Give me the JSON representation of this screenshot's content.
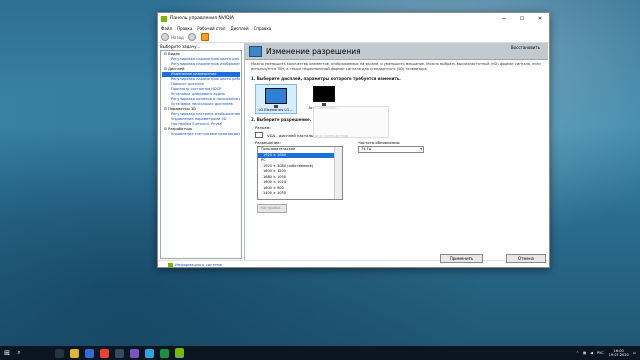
{
  "window": {
    "title": "Панель управления NVIDIA",
    "minimize": "—",
    "maximize": "☐",
    "close": "✕"
  },
  "menu": [
    "Файл",
    "Правка",
    "Рабочий стол",
    "Дисплей",
    "Справка"
  ],
  "toolbar": {
    "back": "Назад"
  },
  "left_panel": {
    "header": "Выберите задачу...",
    "tree": [
      {
        "type": "cat",
        "label": "⊟ Видео"
      },
      {
        "type": "it",
        "label": "Регулировка параметров цвета для видео"
      },
      {
        "type": "it",
        "label": "Регулировка параметров изображения для видео"
      },
      {
        "type": "cat",
        "label": "⊟ Дисплей"
      },
      {
        "type": "it",
        "label": "Изменение разрешения",
        "selected": true
      },
      {
        "type": "it",
        "label": "Регулировка параметров цвета рабочего стола"
      },
      {
        "type": "it",
        "label": "Поворот дисплея"
      },
      {
        "type": "it",
        "label": "Просмотр состояния HDCP"
      },
      {
        "type": "it",
        "label": "Установка цифрового аудио"
      },
      {
        "type": "it",
        "label": "Регулировка размера и положения рабочего стола"
      },
      {
        "type": "it",
        "label": "Установка нескольких дисплеев"
      },
      {
        "type": "cat",
        "label": "⊟ Параметры 3D"
      },
      {
        "type": "it",
        "label": "Регулировка настроек изображения с просмотром"
      },
      {
        "type": "it",
        "label": "Управление параметрами 3D"
      },
      {
        "type": "it",
        "label": "Настройка Surround, PhysX"
      },
      {
        "type": "cat",
        "label": "⊟ Разработчик"
      },
      {
        "type": "it",
        "label": "Управление счетчиками производительности"
      }
    ]
  },
  "content": {
    "title": "Изменение разрешения",
    "restore": "Восстановить",
    "description": "Можно уменьшить количество элементов, отображаемых на экране, и уменьшить мерцание. Можно выбрать высокочастотный (HD) формат сигнала, если используется ТВЧ, а также национальный формат сигнала для стандартного (SD) телевизора.",
    "step1": "1. Выберите дисплей, параметры которого требуется изменить.",
    "monitors": [
      {
        "label": "LG Electronics LG ...",
        "selected": true
      },
      {
        "label": "Acer Communic...",
        "selected": false
      }
    ],
    "step2": "2. Выберите разрешение.",
    "display_label": "Разъем:",
    "display_value": "VGA - дисплей настольного компьютера",
    "resolution_label": "Разрешение:",
    "resolution_list": [
      {
        "type": "grp",
        "label": "Пользовательское"
      },
      {
        "type": "opt",
        "label": "1920 × 1080",
        "selected": true
      },
      {
        "type": "grp",
        "label": "PC"
      },
      {
        "type": "opt",
        "label": "1920 × 1080 (собственное)"
      },
      {
        "type": "opt",
        "label": "1600 × 1200"
      },
      {
        "type": "opt",
        "label": "1680 × 1050"
      },
      {
        "type": "opt",
        "label": "1600 × 1024"
      },
      {
        "type": "opt",
        "label": "1600 × 900"
      },
      {
        "type": "opt",
        "label": "1400 × 1050"
      }
    ],
    "refresh_label": "Частота обновления:",
    "refresh_value": "74 Гц",
    "tooltip": "",
    "settings_button": "Настройка..."
  },
  "bottom": {
    "system_info": "Информация о системе",
    "apply": "Применить",
    "cancel": "Отмена"
  },
  "taskbar": {
    "start": "⊞",
    "search": "⌕",
    "apps": [
      {
        "name": "task-view-icon",
        "color": "#263544"
      },
      {
        "name": "explorer-icon",
        "color": "#e2b33a"
      },
      {
        "name": "mail-icon",
        "color": "#2a6fd6"
      },
      {
        "name": "chrome-icon",
        "color": "#e94235"
      },
      {
        "name": "steam-icon",
        "color": "#334b63"
      },
      {
        "name": "viber-icon",
        "color": "#7d53c7"
      },
      {
        "name": "telegram-icon",
        "color": "#2ea6df"
      },
      {
        "name": "terminal-icon",
        "color": "#1a8f3c"
      },
      {
        "name": "nvidia-icon",
        "color": "#76b900"
      }
    ],
    "lang": "РУС",
    "time": "16:00",
    "date": "19.07.2020"
  }
}
